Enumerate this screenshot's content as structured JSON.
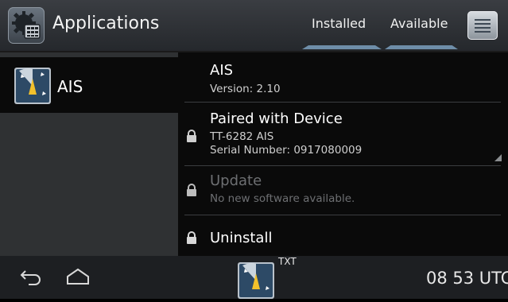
{
  "header": {
    "title": "Applications",
    "tabs": [
      {
        "label": "Installed"
      },
      {
        "label": "Available"
      }
    ]
  },
  "left_panel": {
    "items": [
      {
        "label": "AIS"
      }
    ]
  },
  "details": {
    "app_name": "AIS",
    "version": "Version: 2.10",
    "paired": {
      "title": "Paired with Device",
      "device": "TT-6282 AIS",
      "serial": "Serial Number: 0917080009"
    },
    "update": {
      "title": "Update",
      "status": "No new software available."
    },
    "uninstall": {
      "title": "Uninstall"
    }
  },
  "statusbar": {
    "txt_label": "TXT",
    "time": "08 53 UTC"
  },
  "colors": {
    "accent_underline": "#6e8da8",
    "disabled_text": "#6d6f72"
  },
  "icons": [
    "applications-gear-icon",
    "menu-list-icon",
    "ais-radar-icon",
    "lock-icon",
    "back-icon",
    "home-icon"
  ]
}
